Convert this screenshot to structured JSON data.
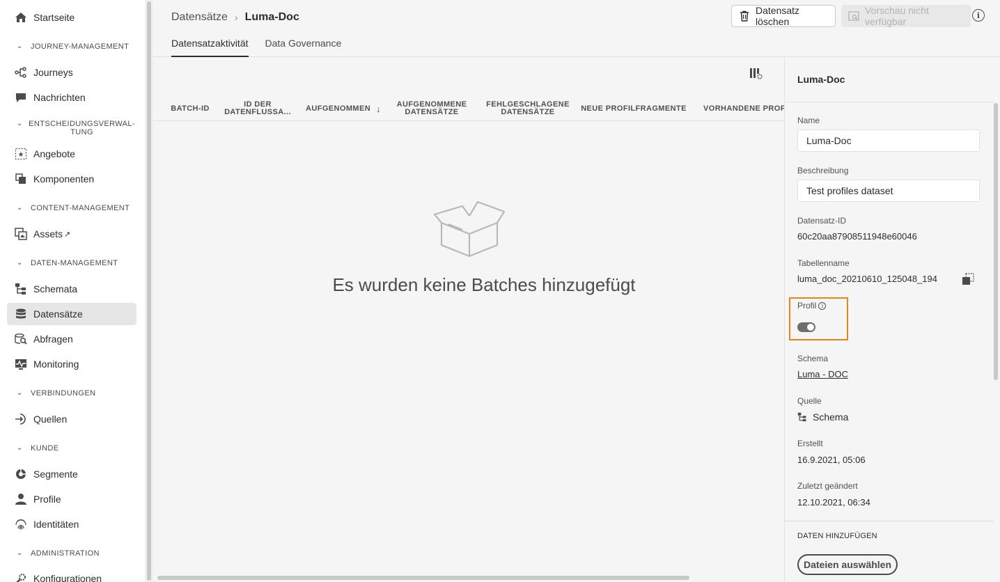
{
  "sidebar": {
    "items": [
      {
        "label": "Startseite",
        "icon": "home-icon"
      },
      {
        "section": "JOURNEY-MANAGEMENT"
      },
      {
        "label": "Journeys",
        "icon": "journeys-icon"
      },
      {
        "label": "Nachrichten",
        "icon": "messages-icon"
      },
      {
        "section": "ENTSCHEIDUNGSVERWAL-TUNG"
      },
      {
        "label": "Angebote",
        "icon": "offers-icon"
      },
      {
        "label": "Komponenten",
        "icon": "components-icon"
      },
      {
        "section": "CONTENT-MANAGEMENT"
      },
      {
        "label": "Assets",
        "icon": "assets-icon"
      },
      {
        "section": "DATEN-MANAGEMENT"
      },
      {
        "label": "Schemata",
        "icon": "schemas-icon"
      },
      {
        "label": "Datensätze",
        "icon": "datasets-icon",
        "active": true
      },
      {
        "label": "Abfragen",
        "icon": "queries-icon"
      },
      {
        "label": "Monitoring",
        "icon": "monitoring-icon"
      },
      {
        "section": "VERBINDUNGEN"
      },
      {
        "label": "Quellen",
        "icon": "sources-icon"
      },
      {
        "section": "KUNDE"
      },
      {
        "label": "Segmente",
        "icon": "segments-icon"
      },
      {
        "label": "Profile",
        "icon": "profile-icon"
      },
      {
        "label": "Identitäten",
        "icon": "identities-icon"
      },
      {
        "section": "ADMINISTRATION"
      },
      {
        "label": "Konfigurationen",
        "icon": "configurations-icon"
      }
    ],
    "section_line1_entscheidung": "ENTSCHEIDUNGSVERWAL-",
    "section_line2_entscheidung": "TUNG"
  },
  "header": {
    "breadcrumb_parent": "Datensätze",
    "breadcrumb_current": "Luma-Doc",
    "delete_label": "Datensatz löschen",
    "preview_label": "Vorschau nicht verfügbar",
    "tabs": [
      {
        "label": "Datensatzaktivität",
        "active": true
      },
      {
        "label": "Data Governance",
        "active": false
      }
    ]
  },
  "table": {
    "columns": [
      {
        "label": "BATCH-ID"
      },
      {
        "label": "ID DER DATENFLUSSA..."
      },
      {
        "label": "AUFGENOMMEN"
      },
      {
        "label": "AUFGENOMMENE DATENSÄTZE"
      },
      {
        "label": "FEHLGESCHLAGENE DATENSÄTZE"
      },
      {
        "label": "NEUE PROFILFRAGMENTE"
      },
      {
        "label": "VORHANDENE PROFI"
      }
    ],
    "col_lines": {
      "c1a": "ID DER",
      "c1b": "DATENFLUSSA...",
      "c3a": "AUFGENOMMENE",
      "c3b": "DATENSÄTZE",
      "c4a": "FEHLGESCHLAGENE",
      "c4b": "DATENSÄTZE"
    },
    "empty_message": "Es wurden keine Batches hinzugefügt"
  },
  "panel": {
    "title": "Luma-Doc",
    "name_label": "Name",
    "name_value": "Luma-Doc",
    "description_label": "Beschreibung",
    "description_value": "Test profiles dataset",
    "dataset_id_label": "Datensatz-ID",
    "dataset_id_value": "60c20aa87908511948e60046",
    "table_name_label": "Tabellenname",
    "table_name_value": "luma_doc_20210610_125048_194",
    "profile_label": "Profil",
    "profile_enabled": true,
    "schema_label": "Schema",
    "schema_value": "Luma - DOC",
    "source_label": "Quelle",
    "source_value": "Schema",
    "created_label": "Erstellt",
    "created_value": "16.9.2021, 05:06",
    "modified_label": "Zuletzt geändert",
    "modified_value": "12.10.2021, 06:34",
    "add_data_title": "DATEN HINZUFÜGEN",
    "select_files_label": "Dateien auswählen"
  },
  "colors": {
    "highlight": "#e68619",
    "active_nav": "#e6e6e6",
    "background": "#f5f5f5"
  }
}
